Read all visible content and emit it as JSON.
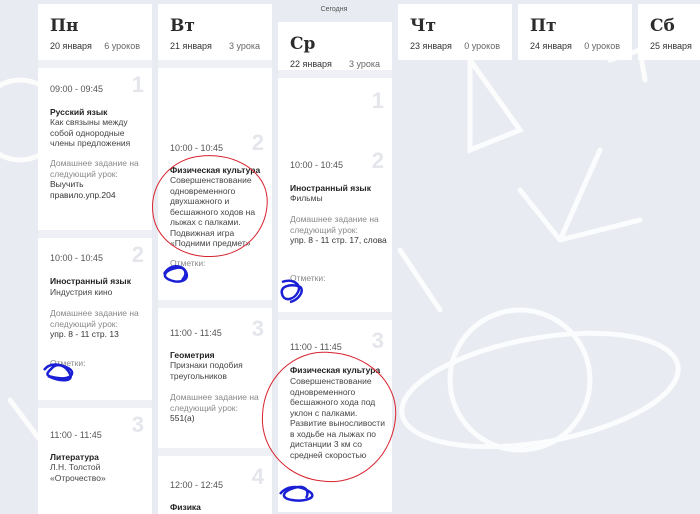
{
  "today_label": "Сегодня",
  "days": [
    {
      "name": "Пн",
      "date": "20 января",
      "count": "6 уроков"
    },
    {
      "name": "Вт",
      "date": "21 января",
      "count": "3 урока"
    },
    {
      "name": "Ср",
      "date": "22 января",
      "count": "3 урока"
    },
    {
      "name": "Чт",
      "date": "23 января",
      "count": "0 уроков"
    },
    {
      "name": "Пт",
      "date": "24 января",
      "count": "0 уроков"
    },
    {
      "name": "Сб",
      "date": "25 января"
    }
  ],
  "hw_label": "Домашнее задание на следующий урок:",
  "marks_label": "Отметки:",
  "mon": [
    {
      "num": "1",
      "time": "09:00 - 09:45",
      "subject": "Русский язык",
      "topic": "Как связыны между собой однородные члены предложения",
      "hw": "Выучить правило.упр.204"
    },
    {
      "num": "2",
      "time": "10:00 - 10:45",
      "subject": "Иностранный язык",
      "topic": "Индустрия кино",
      "hw": "упр. 8 - 11 стр. 13"
    },
    {
      "num": "3",
      "time": "11:00 - 11:45",
      "subject": "Литература",
      "topic": "Л.Н. Толстой «Отрочество»"
    }
  ],
  "tue": [
    {
      "num": "2",
      "time": "10:00 - 10:45",
      "subject": "Физическая культура",
      "topic": "Совершенствование одновременного двухшажного и бесшажного ходов на лыжах с палками. Подвижная игра «Подними предмет»"
    },
    {
      "num": "3",
      "time": "11:00 - 11:45",
      "subject": "Геометрия",
      "topic": "Признаки подобия треугольников",
      "hw": "551(а)"
    },
    {
      "num": "4",
      "time": "12:00 - 12:45",
      "subject": "Физика"
    }
  ],
  "wed": [
    {
      "num": "1"
    },
    {
      "num": "2",
      "time": "10:00 - 10:45",
      "subject": "Иностранный язык",
      "topic": "Фильмы",
      "hw": "упр. 8 - 11 стр. 17, слова"
    },
    {
      "num": "3",
      "time": "11:00 - 11:45",
      "subject": "Физическая культура",
      "topic": "Совершенствование одновременного бесшажного хода под уклон с палками. Развитие выносливости в ходьбе на лыжах по дистанции 3 км со средней скоростью"
    }
  ],
  "colors": {
    "background": "#e9ebf2",
    "annotation_red": "#d8232e",
    "annotation_blue": "#1a1fd6"
  }
}
